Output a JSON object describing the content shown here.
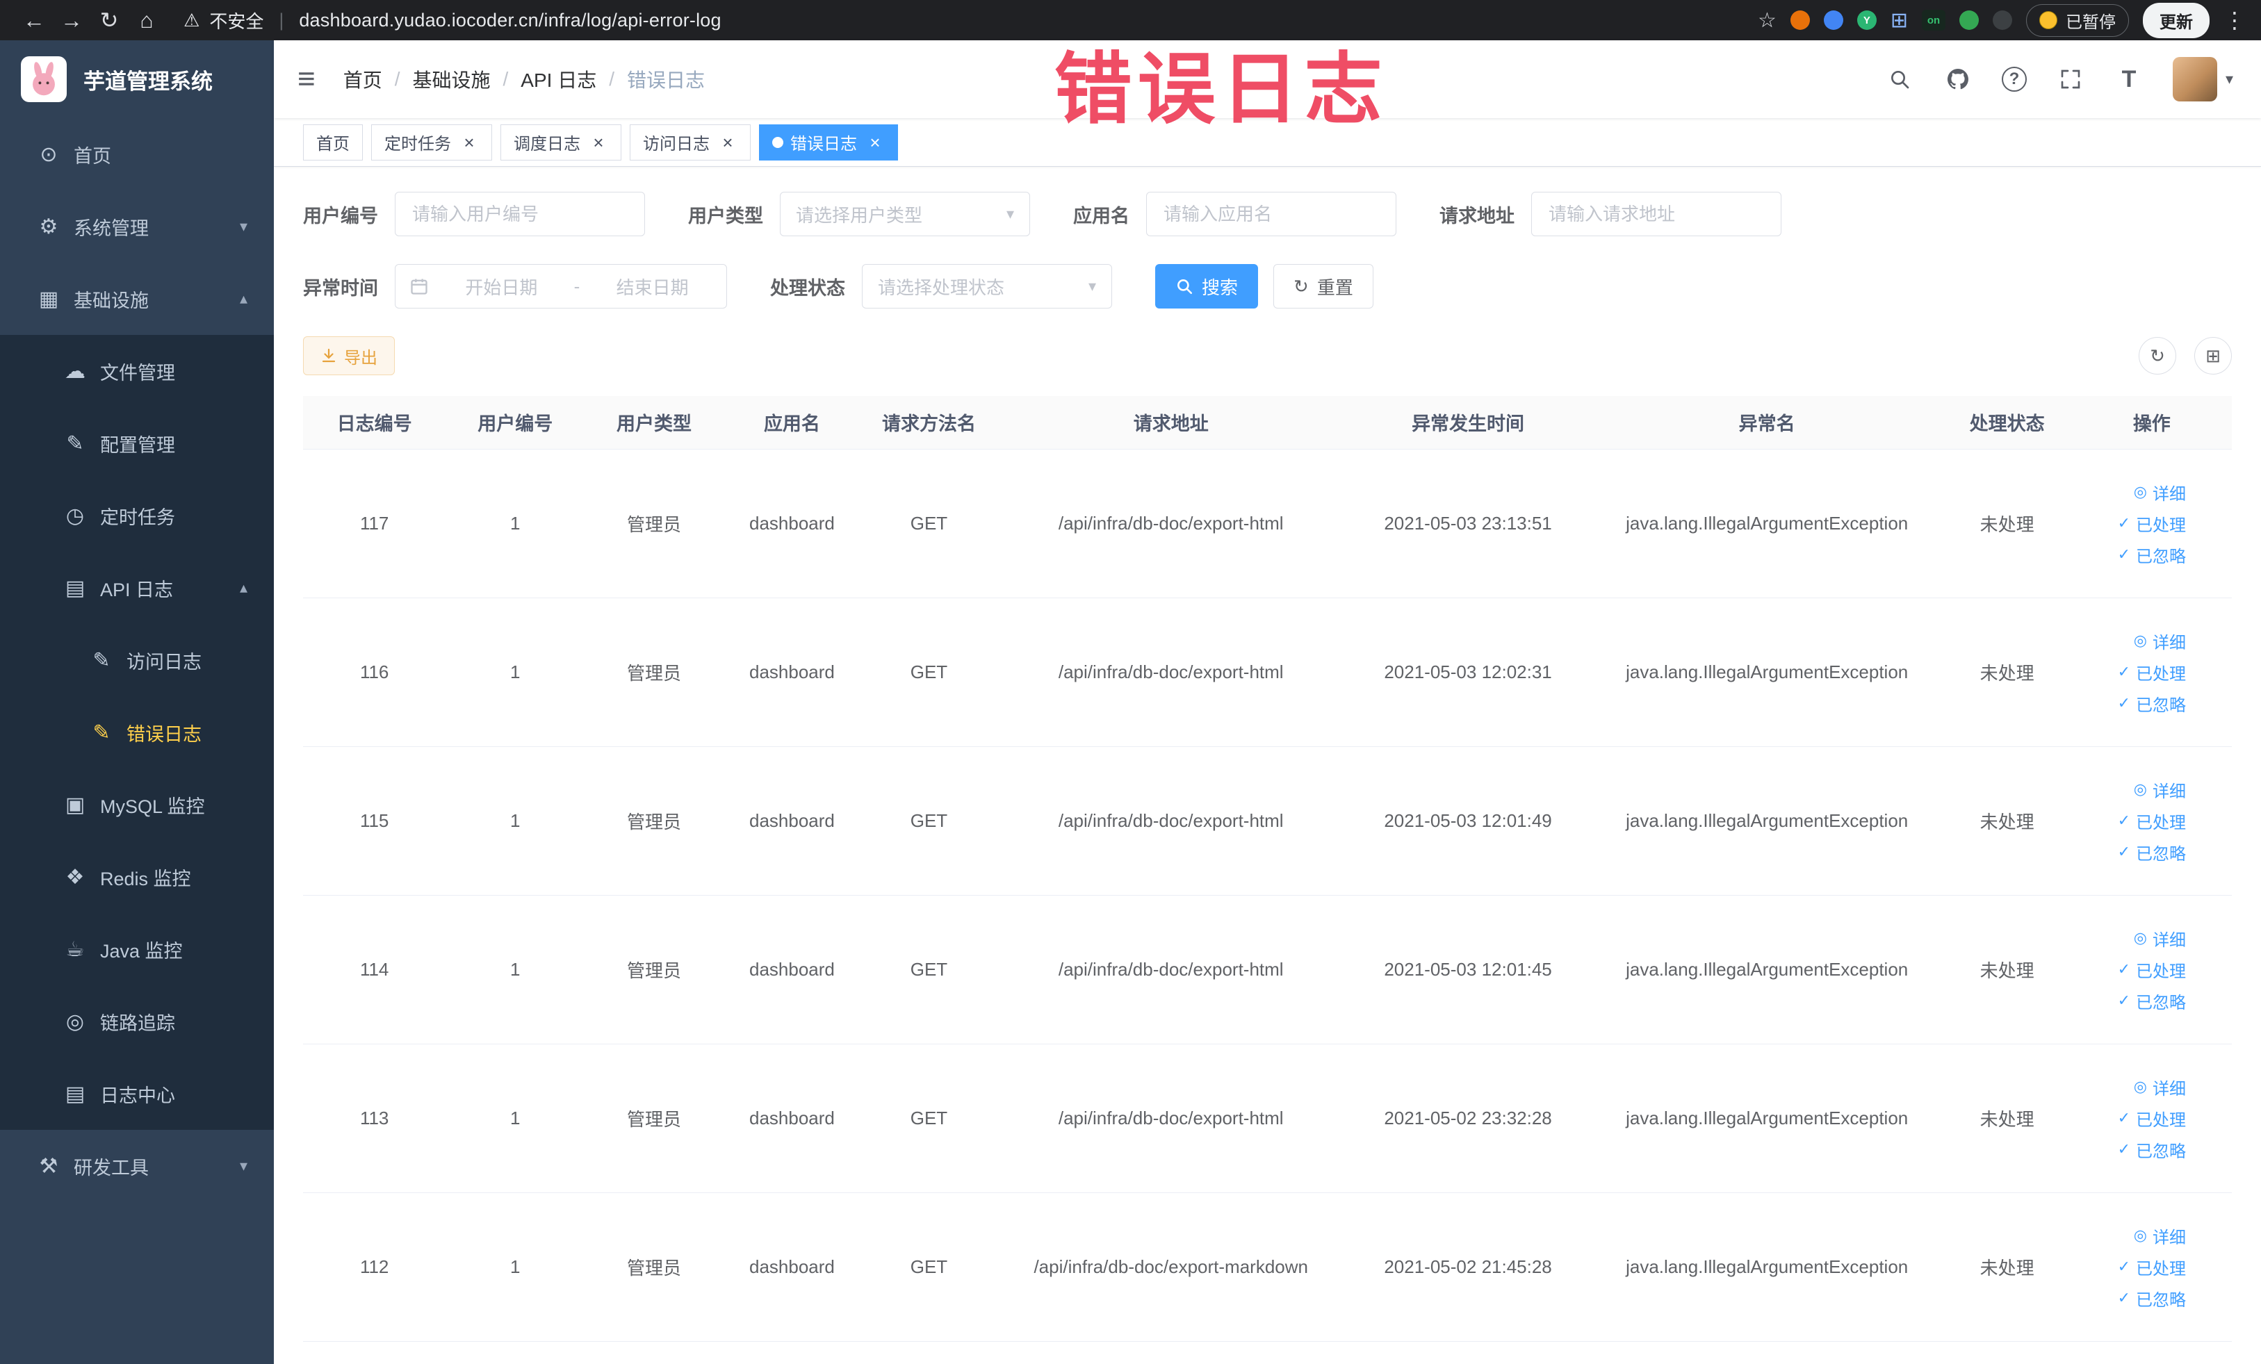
{
  "browser": {
    "security_label": "不安全",
    "url": "dashboard.yudao.iocoder.cn/infra/log/api-error-log",
    "paused_badge": "已暂停",
    "update_label": "更新",
    "on_badge": "on",
    "ext_letter": "Y"
  },
  "glyphs": {
    "back": "←",
    "forward": "→",
    "reload": "↻",
    "home": "⌂",
    "warning": "⚠",
    "pipe": "|",
    "star": "☆",
    "more": "⋮",
    "hamburger": "≡",
    "caret_down": "▾",
    "arrow_down": "▾",
    "arrow_up": "▴",
    "check": "✓",
    "close": "×",
    "question": "?",
    "font_size": "T",
    "refresh": "↻",
    "grid": "⊞",
    "eye": "◎",
    "download": "↓"
  },
  "sidebar": {
    "logo_title": "芋道管理系统",
    "items": [
      {
        "key": "home",
        "label": "首页",
        "icon": "dashboard-icon",
        "glyph": "⊙",
        "level": 0
      },
      {
        "key": "system",
        "label": "系统管理",
        "icon": "gear-icon",
        "glyph": "⚙",
        "level": 0,
        "arrow": "down"
      },
      {
        "key": "infrastructure",
        "label": "基础设施",
        "icon": "grid-icon",
        "glyph": "▦",
        "level": 0,
        "arrow": "up"
      },
      {
        "key": "file",
        "label": "文件管理",
        "icon": "cloud-icon",
        "glyph": "☁",
        "level": 1
      },
      {
        "key": "config",
        "label": "配置管理",
        "icon": "edit-icon",
        "glyph": "✎",
        "level": 1
      },
      {
        "key": "job",
        "label": "定时任务",
        "icon": "clock-icon",
        "glyph": "◷",
        "level": 1
      },
      {
        "key": "api-log",
        "label": "API 日志",
        "icon": "document-icon",
        "glyph": "▤",
        "level": 1,
        "arrow": "up"
      },
      {
        "key": "access-log",
        "label": "访问日志",
        "icon": "edit-square-icon",
        "glyph": "✎",
        "level": 2
      },
      {
        "key": "error-log",
        "label": "错误日志",
        "icon": "edit-square-icon",
        "glyph": "✎",
        "level": 2,
        "active": true
      },
      {
        "key": "mysql",
        "label": "MySQL 监控",
        "icon": "database-icon",
        "glyph": "▣",
        "level": 1
      },
      {
        "key": "redis",
        "label": "Redis 监控",
        "icon": "layers-icon",
        "glyph": "❖",
        "level": 1
      },
      {
        "key": "java",
        "label": "Java 监控",
        "icon": "coffee-icon",
        "glyph": "☕",
        "level": 1
      },
      {
        "key": "trace",
        "label": "链路追踪",
        "icon": "eye-icon",
        "glyph": "◎",
        "level": 1
      },
      {
        "key": "log-center",
        "label": "日志中心",
        "icon": "document-icon",
        "glyph": "▤",
        "level": 1
      },
      {
        "key": "dev-tools",
        "label": "研发工具",
        "icon": "tools-icon",
        "glyph": "⚒",
        "level": 0,
        "arrow": "down"
      }
    ]
  },
  "header": {
    "breadcrumb": [
      "首页",
      "基础设施",
      "API 日志",
      "错误日志"
    ],
    "watermark": "错误日志"
  },
  "tabs": [
    {
      "key": "home",
      "label": "首页",
      "closable": false,
      "active": false
    },
    {
      "key": "job",
      "label": "定时任务",
      "closable": true,
      "active": false
    },
    {
      "key": "job-log",
      "label": "调度日志",
      "closable": true,
      "active": false
    },
    {
      "key": "access-log",
      "label": "访问日志",
      "closable": true,
      "active": false
    },
    {
      "key": "error-log",
      "label": "错误日志",
      "closable": true,
      "active": true
    }
  ],
  "filters": {
    "user_id": {
      "label": "用户编号",
      "placeholder": "请输入用户编号"
    },
    "user_type": {
      "label": "用户类型",
      "placeholder": "请选择用户类型"
    },
    "app_name": {
      "label": "应用名",
      "placeholder": "请输入应用名"
    },
    "request_url": {
      "label": "请求地址",
      "placeholder": "请输入请求地址"
    },
    "exception_time": {
      "label": "异常时间",
      "start_placeholder": "开始日期",
      "separator": "-",
      "end_placeholder": "结束日期"
    },
    "process_status": {
      "label": "处理状态",
      "placeholder": "请选择处理状态"
    },
    "search_label": "搜索",
    "reset_label": "重置"
  },
  "toolbar": {
    "export_label": "导出"
  },
  "table": {
    "columns": [
      "日志编号",
      "用户编号",
      "用户类型",
      "应用名",
      "请求方法名",
      "请求地址",
      "异常发生时间",
      "异常名",
      "处理状态",
      "操作"
    ],
    "actions": [
      {
        "key": "detail",
        "label": "详细",
        "icon": "eye"
      },
      {
        "key": "processed",
        "label": "已处理",
        "icon": "check"
      },
      {
        "key": "ignored",
        "label": "已忽略",
        "icon": "check"
      }
    ],
    "rows": [
      {
        "id": "117",
        "user_id": "1",
        "user_type": "管理员",
        "app": "dashboard",
        "method": "GET",
        "url": "/api/infra/db-doc/export-html",
        "time": "2021-05-03 23:13:51",
        "exception": "java.lang.IllegalArgumentException",
        "status": "未处理"
      },
      {
        "id": "116",
        "user_id": "1",
        "user_type": "管理员",
        "app": "dashboard",
        "method": "GET",
        "url": "/api/infra/db-doc/export-html",
        "time": "2021-05-03 12:02:31",
        "exception": "java.lang.IllegalArgumentException",
        "status": "未处理"
      },
      {
        "id": "115",
        "user_id": "1",
        "user_type": "管理员",
        "app": "dashboard",
        "method": "GET",
        "url": "/api/infra/db-doc/export-html",
        "time": "2021-05-03 12:01:49",
        "exception": "java.lang.IllegalArgumentException",
        "status": "未处理"
      },
      {
        "id": "114",
        "user_id": "1",
        "user_type": "管理员",
        "app": "dashboard",
        "method": "GET",
        "url": "/api/infra/db-doc/export-html",
        "time": "2021-05-03 12:01:45",
        "exception": "java.lang.IllegalArgumentException",
        "status": "未处理"
      },
      {
        "id": "113",
        "user_id": "1",
        "user_type": "管理员",
        "app": "dashboard",
        "method": "GET",
        "url": "/api/infra/db-doc/export-html",
        "time": "2021-05-02 23:32:28",
        "exception": "java.lang.IllegalArgumentException",
        "status": "未处理"
      },
      {
        "id": "112",
        "user_id": "1",
        "user_type": "管理员",
        "app": "dashboard",
        "method": "GET",
        "url": "/api/infra/db-doc/export-markdown",
        "time": "2021-05-02 21:45:28",
        "exception": "java.lang.IllegalArgumentException",
        "status": "未处理"
      }
    ]
  }
}
